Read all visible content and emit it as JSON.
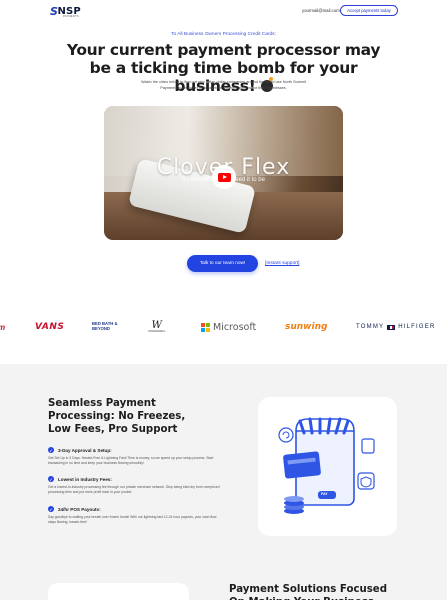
{
  "header": {
    "logo_mark": "S",
    "logo_text": "NSP",
    "logo_sub": "PAYMENTS",
    "email": "yourmail@mail.com",
    "cta_label": "Accept payments today"
  },
  "hero": {
    "kicker": "To All Business Owners Processing Credit Cards:",
    "headline": "Your current payment processor may be a ticking time bomb for your business!",
    "subcopy": "Watch the video below to find out why billion dollar companies around the world use North Summit Payments to empower their payment systems and protect their businesses.",
    "video_title": "Clover Flex",
    "video_sub": "It's everything you need it to be",
    "cta_label": "Talk to our team now!",
    "support_label": "[Instant support]"
  },
  "logos": {
    "m": "m",
    "vans": "VANS",
    "bbb_line1": "BED BATH &",
    "bbb_line2": "BEYOND",
    "vw_mark": "W",
    "vw_text": "VANDERWEIL",
    "microsoft": "Microsoft",
    "sunwing": "sunwing",
    "tommy_left": "TOMMY",
    "tommy_right": "HILFIGER"
  },
  "features": {
    "title": "Seamless Payment Processing: No Freezes, Low Fees, Pro Support",
    "items": [
      {
        "head": "3-Day Approval & Setup:",
        "desc": "Get Set Up in 3 Days: Hassle-Free & Lightning Fast! Time is money, so we speed up your setup process. Start transacting in no time and keep your business flowing smoothly!"
      },
      {
        "head": "Lowest in Industry Fees:",
        "desc": "Get a lowest-in-industry processing fee through our private merchant network. Stop being bled dry from overpriced processing fees and put more profit back in your pocket."
      },
      {
        "head": "24/hr POS Payouts:",
        "desc": "Say goodbye to waiting your breath over frozen funds! With our lightning fast 12-24 hour payouts, your cash flow stays flowing, hassle-free!"
      }
    ],
    "illustration_icons": [
      "refresh-icon",
      "shield-icon",
      "document-icon"
    ],
    "illustration_card_label": "PAY"
  },
  "bottom": {
    "title": "Payment Solutions Focused On Making Your Business"
  },
  "colors": {
    "brand_blue": "#2344e0",
    "logo_blue": "#1f3fb3",
    "section_gray": "#f3f3f4"
  }
}
